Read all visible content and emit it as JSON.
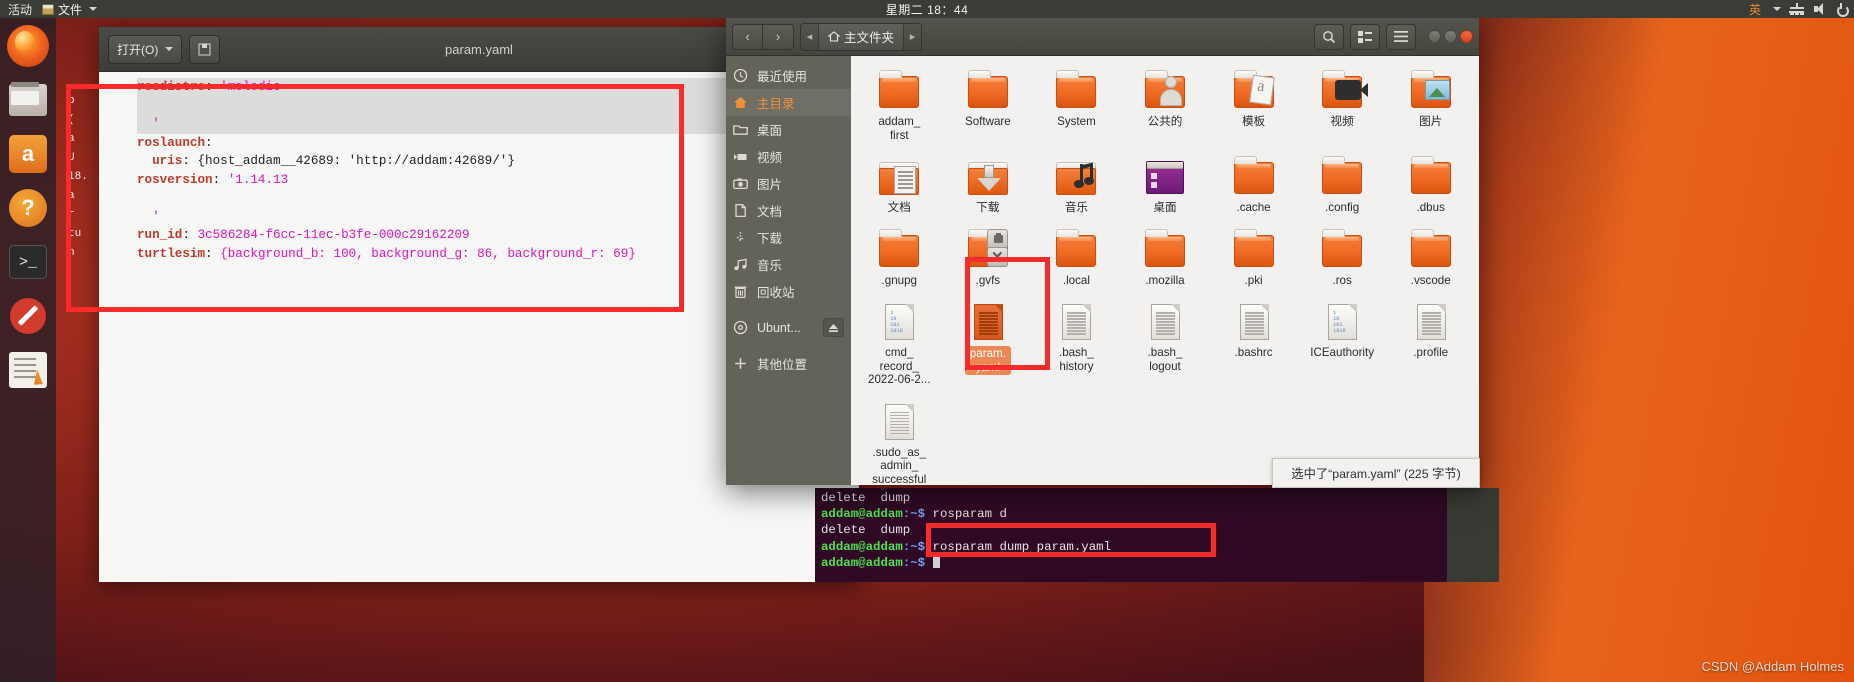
{
  "topbar": {
    "activities": "活动",
    "app_menu": "文件",
    "clock": "星期二 18：44",
    "ime": "英"
  },
  "launcher": {
    "items": [
      {
        "name": "firefox",
        "label": "Firefox"
      },
      {
        "name": "files",
        "label": "文件"
      },
      {
        "name": "amazon",
        "label": "Amazon"
      },
      {
        "name": "help",
        "label": "帮助"
      },
      {
        "name": "terminal",
        "label": "终端"
      },
      {
        "name": "deny",
        "label": "系统设置"
      },
      {
        "name": "text-editor",
        "label": "文本编辑器"
      }
    ]
  },
  "gedit": {
    "title": "param.yaml",
    "open_button": "打开(O)",
    "save_button": "保存",
    "code_lines": [
      {
        "segments": [
          {
            "t": "rosdistro",
            "c": "k"
          },
          {
            "t": ": ",
            "c": "p"
          },
          {
            "t": "'melodic",
            "c": "s"
          }
        ],
        "selected": true
      },
      {
        "segments": [
          {
            "t": "",
            "c": "p"
          }
        ],
        "selected": true
      },
      {
        "segments": [
          {
            "t": "  '",
            "c": "s"
          }
        ],
        "selected": true
      },
      {
        "segments": [
          {
            "t": "roslaunch",
            "c": "k"
          },
          {
            "t": ":",
            "c": "p"
          }
        ],
        "selected": false
      },
      {
        "segments": [
          {
            "t": "  uris",
            "c": "k"
          },
          {
            "t": ": {host_addam__42689: 'http://addam:42689/'}",
            "c": "p"
          }
        ],
        "selected": false
      },
      {
        "segments": [
          {
            "t": "rosversion",
            "c": "k"
          },
          {
            "t": ": ",
            "c": "p"
          },
          {
            "t": "'1.14.13",
            "c": "s"
          }
        ],
        "selected": false
      },
      {
        "segments": [
          {
            "t": "",
            "c": "p"
          }
        ],
        "selected": false
      },
      {
        "segments": [
          {
            "t": "  '",
            "c": "s"
          }
        ],
        "selected": false
      },
      {
        "segments": [
          {
            "t": "run_id",
            "c": "k"
          },
          {
            "t": ": ",
            "c": "p"
          },
          {
            "t": "3c586284-f6cc-11ec-b3fe-000c29162209",
            "c": "n"
          }
        ],
        "selected": false
      },
      {
        "segments": [
          {
            "t": "turtlesim",
            "c": "k"
          },
          {
            "t": ": ",
            "c": "p"
          },
          {
            "t": "{background_b: 100, background_g: 86, background_r: 69}",
            "c": "n"
          }
        ],
        "selected": false
      }
    ],
    "behind_lines": [
      "b",
      "(",
      "a",
      "U",
      "18.",
      "a",
      "",
      "",
      "r",
      "tu",
      "n"
    ]
  },
  "nautilus": {
    "breadcrumb": "主文件夹",
    "sidebar": [
      {
        "label": "最近使用",
        "icon": "clock-icon",
        "selected": false
      },
      {
        "label": "主目录",
        "icon": "home-icon",
        "selected": true
      },
      {
        "label": "桌面",
        "icon": "folder-icon",
        "selected": false
      },
      {
        "label": "视频",
        "icon": "video-icon",
        "selected": false
      },
      {
        "label": "图片",
        "icon": "camera-icon",
        "selected": false
      },
      {
        "label": "文档",
        "icon": "document-icon",
        "selected": false
      },
      {
        "label": "下载",
        "icon": "download-icon",
        "selected": false
      },
      {
        "label": "音乐",
        "icon": "music-icon",
        "selected": false
      },
      {
        "label": "回收站",
        "icon": "trash-icon",
        "selected": false
      },
      {
        "label": "Ubunt...",
        "icon": "disc-icon",
        "selected": false,
        "eject": true
      },
      {
        "label": "其他位置",
        "icon": "plus-icon",
        "selected": false
      }
    ],
    "files": [
      {
        "name": "addam_\nfirst",
        "kind": "folder",
        "selected": false
      },
      {
        "name": "Software",
        "kind": "folder",
        "selected": false
      },
      {
        "name": "System",
        "kind": "folder",
        "selected": false
      },
      {
        "name": "公共的",
        "kind": "folder-person",
        "selected": false
      },
      {
        "name": "模板",
        "kind": "folder-template",
        "selected": false
      },
      {
        "name": "视频",
        "kind": "folder-video",
        "selected": false
      },
      {
        "name": "图片",
        "kind": "folder-picture",
        "selected": false
      },
      {
        "name": "文档",
        "kind": "folder-doc",
        "selected": false
      },
      {
        "name": "下载",
        "kind": "folder-down",
        "selected": false
      },
      {
        "name": "音乐",
        "kind": "folder-music",
        "selected": false
      },
      {
        "name": "桌面",
        "kind": "desktop",
        "selected": false
      },
      {
        "name": ".cache",
        "kind": "folder",
        "selected": false
      },
      {
        "name": ".config",
        "kind": "folder",
        "selected": false
      },
      {
        "name": ".dbus",
        "kind": "folder",
        "selected": false
      },
      {
        "name": ".gnupg",
        "kind": "folder",
        "selected": false
      },
      {
        "name": ".gvfs",
        "kind": "folder-locked",
        "selected": false
      },
      {
        "name": ".local",
        "kind": "folder",
        "selected": false
      },
      {
        "name": ".mozilla",
        "kind": "folder",
        "selected": false
      },
      {
        "name": ".pki",
        "kind": "folder",
        "selected": false
      },
      {
        "name": ".ros",
        "kind": "folder",
        "selected": false
      },
      {
        "name": ".vscode",
        "kind": "folder",
        "selected": false
      },
      {
        "name": "cmd_\nrecord_\n2022-06-2...",
        "kind": "doc-binary",
        "selected": false
      },
      {
        "name": "param.\nyaml",
        "kind": "doc-orange",
        "selected": true
      },
      {
        "name": ".bash_\nhistory",
        "kind": "doc",
        "selected": false
      },
      {
        "name": ".bash_\nlogout",
        "kind": "doc",
        "selected": false
      },
      {
        "name": ".bashrc",
        "kind": "doc",
        "selected": false
      },
      {
        "name": "ICEauthority",
        "kind": "doc-binary",
        "selected": false
      },
      {
        "name": ".profile",
        "kind": "doc",
        "selected": false
      },
      {
        "name": ".sudo_as_\nadmin_\nsuccessful",
        "kind": "doc",
        "selected": false
      }
    ],
    "status": "选中了“param.yaml” (225 字节)"
  },
  "terminal": {
    "lines": [
      {
        "prompt": "",
        "path": "",
        "cmd": "delete  dump",
        "plain": true
      },
      {
        "prompt": "addam@addam",
        "path": ":~$ ",
        "cmd": "rosparam d",
        "plain": false
      },
      {
        "prompt": "",
        "path": "",
        "cmd": "delete  dump",
        "plain": true
      },
      {
        "prompt": "addam@addam",
        "path": ":~$ ",
        "cmd": "rosparam dump param.yaml",
        "plain": false
      },
      {
        "prompt": "addam@addam",
        "path": ":~$ ",
        "cmd": "",
        "plain": false
      }
    ]
  },
  "watermark": "CSDN @Addam Holmes"
}
